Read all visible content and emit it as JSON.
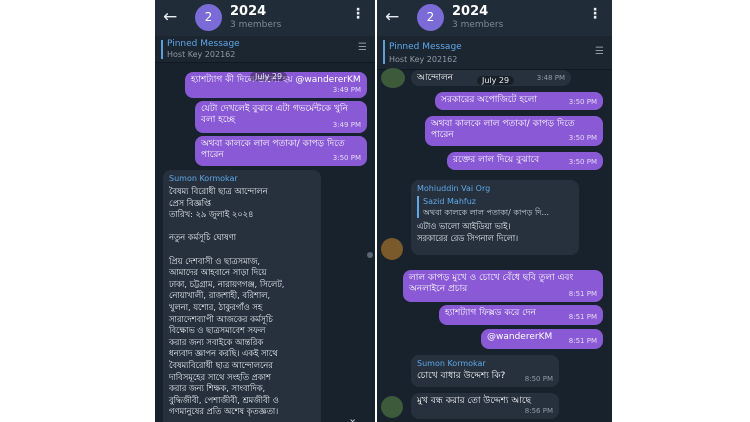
{
  "left": {
    "header": {
      "back_icon": "arrow-left-icon",
      "avatar": "2",
      "title": "2024",
      "members": "3 members"
    },
    "pinned": {
      "label": "Pinned Message",
      "text": "Host Key 202162"
    },
    "date_chip": "July 29",
    "messages": [
      {
        "text": "হ্যাশট্যাগ কী দিলে ভালো হয় @wandererKM",
        "time": "3:49 PM"
      },
      {
        "text": "যেটা দেখলেই বুঝবে এটা গভর্মেন্টকে খুনি বলা হচ্ছে",
        "time": "3:49 PM"
      },
      {
        "text": "অথবা কালকে লাল পতাকা/ কাপড় দিতে পারেন",
        "time": "3:50 PM"
      }
    ],
    "long_message": {
      "sender": "Sumon Kormokar",
      "text": "বৈষম্য বিরোধী ছাত্র আন্দোলন\nপ্রেস বিজ্ঞপ্তি\nতারিখ: ২৯ জুলাই ২০২৪\n\nনতুন কর্মসূচি ঘোষণা\n\nপ্রিয় দেশবাসী ও ছাত্রসমাজ,\nআমাদের আহবানে সাড়া দিয়ে\nঢাকা, চট্টগ্রাম, নারায়ণগঞ্জ, সিলেট,\nনোয়াখালী, রাজশাহী, বরিশাল,\nখুলনা, যশোর, ঠাকুরগাঁও সহ\nসারাদেশব্যাপী আজকের কর্মসূচি\nবিক্ষোভ ও ছাত্রসমাবেশ সফল\nকরার জন্য সবাইকে আন্তরিক\nধন্যবাদ জ্ঞাপন করছি। একই সাথে\nবৈষম্যবিরোধী ছাত্র আন্দোলনের\nদাবিসমূহের সাথে সংহতি প্রকাশ\nকরার জন্য শিক্ষক, সাংবাদিক,\nবুদ্ধিজীবী, পেশাজীবী, শ্রমজীবী ও\nগণমানুষের প্রতি অশেষ কৃতজ্ঞতা।"
    }
  },
  "right": {
    "header": {
      "back_icon": "arrow-left-icon",
      "avatar": "2",
      "title": "2024",
      "members": "3 members"
    },
    "pinned": {
      "label": "Pinned Message",
      "text": "Host Key 202162"
    },
    "top_partial": "আন্দোলন",
    "top_date": "July 29",
    "top_time": "3:48 PM",
    "messages_a": [
      {
        "text": "সরকারের অপোজিটে হলো",
        "time": "3:50 PM"
      },
      {
        "text": "অথবা কালকে লাল পতাকা/ কাপড় দিতে পারেন",
        "time": "3:50 PM"
      },
      {
        "text": "রক্তের লাল দিয়ে বুঝাবে",
        "time": "3:50 PM"
      }
    ],
    "reply_message": {
      "sender": "Mohiuddin Vai Org",
      "quote_name": "Sazid Mahfuz",
      "quote_text": "অথবা কালকে লাল পতাকা/ কাপড় দি...",
      "text": "এটাও ভালো আইডিয়া ভাই।\nসরকারের রেড সিগনাল দিলো।"
    },
    "messages_b": [
      {
        "text": "লাল কাপড় মুখে ও চোখে বেঁধে ছবি তুলা এবং অনলাইনে প্রচার",
        "time": "8:51 PM"
      },
      {
        "text": "হ্যাশট্যাগ ফিক্সড করে দেন",
        "time": "8:51 PM"
      },
      {
        "text": "@wandererKM",
        "time": "8:51 PM"
      }
    ],
    "question": {
      "sender": "Sumon Kormokar",
      "text": "চোখে বাধার উদ্দেশ্য কি?",
      "time": "8:50 PM"
    },
    "last": {
      "text": "মুখ বন্ধ করার তো উদ্দেশ্য আছে",
      "time": "8:56 PM"
    }
  }
}
